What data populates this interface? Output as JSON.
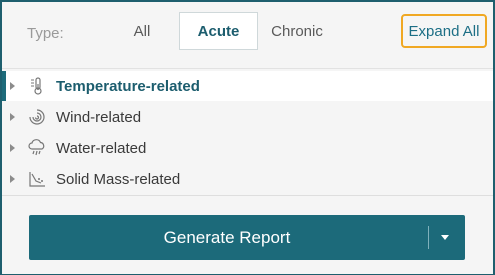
{
  "filter": {
    "type_label": "Type:",
    "tabs": [
      {
        "label": "All",
        "selected": false
      },
      {
        "label": "Acute",
        "selected": true
      },
      {
        "label": "Chronic",
        "selected": false
      }
    ],
    "expand_all_label": "Expand All"
  },
  "tree": {
    "items": [
      {
        "label": "Temperature-related",
        "icon": "thermometer-icon",
        "selected": true
      },
      {
        "label": "Wind-related",
        "icon": "wind-icon",
        "selected": false
      },
      {
        "label": "Water-related",
        "icon": "rain-cloud-icon",
        "selected": false
      },
      {
        "label": "Solid Mass-related",
        "icon": "landslide-icon",
        "selected": false
      }
    ]
  },
  "footer": {
    "generate_label": "Generate Report"
  },
  "colors": {
    "accent": "#1c6a7a",
    "highlight_border": "#f0a823",
    "panel_border": "#1e5f6e"
  }
}
